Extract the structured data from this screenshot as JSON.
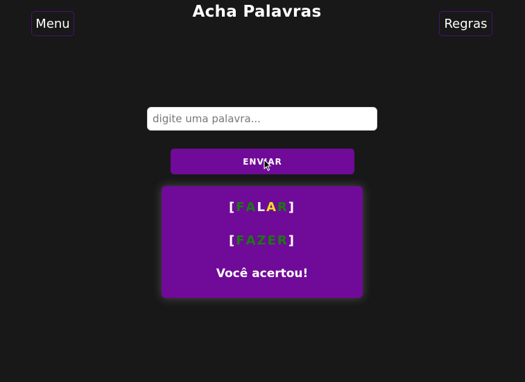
{
  "app": {
    "title": "Acha Palavras"
  },
  "nav": {
    "menu_label": "Menu",
    "rules_label": "Regras"
  },
  "input": {
    "placeholder": "digite uma palavra...",
    "value": ""
  },
  "submit": {
    "label": "ENVIAR"
  },
  "results": {
    "guesses": [
      {
        "letters": [
          {
            "char": "F",
            "state": "correct"
          },
          {
            "char": "A",
            "state": "correct"
          },
          {
            "char": "L",
            "state": "absent"
          },
          {
            "char": "A",
            "state": "present"
          },
          {
            "char": "R",
            "state": "correct"
          }
        ]
      },
      {
        "letters": [
          {
            "char": "F",
            "state": "correct"
          },
          {
            "char": "A",
            "state": "correct"
          },
          {
            "char": "Z",
            "state": "correct"
          },
          {
            "char": "E",
            "state": "correct"
          },
          {
            "char": "R",
            "state": "correct"
          }
        ]
      }
    ],
    "message": "Você acertou!"
  },
  "colors": {
    "background": "#181818",
    "accent": "#700a98",
    "correct": "#1a7a12",
    "present": "#f3e11b",
    "absent": "#ffffff"
  },
  "icons": {
    "cursor": "mouse-pointer-icon"
  }
}
